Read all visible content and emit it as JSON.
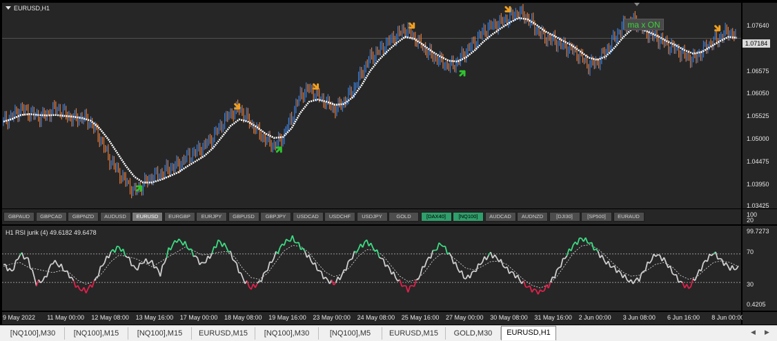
{
  "window": {
    "symbol_title": "EURUSD,H1",
    "overlay_label": "ma x ON"
  },
  "price_axis": {
    "current_price": "1.07184",
    "ticks": [
      "1.07640",
      "1.07115",
      "1.06575",
      "1.06050",
      "1.05525",
      "1.05000",
      "1.04475",
      "1.03950",
      "1.03425"
    ]
  },
  "symbol_buttons": [
    {
      "label": "GBPAUD",
      "state": "normal"
    },
    {
      "label": "GBPCAD",
      "state": "normal"
    },
    {
      "label": "GBPNZD",
      "state": "normal"
    },
    {
      "label": "AUDUSD",
      "state": "normal"
    },
    {
      "label": "EURUSD",
      "state": "active"
    },
    {
      "label": "EURGBP",
      "state": "normal"
    },
    {
      "label": "EURJPY",
      "state": "normal"
    },
    {
      "label": "GBPUSD",
      "state": "normal"
    },
    {
      "label": "GBPJPY",
      "state": "normal"
    },
    {
      "label": "USDCAD",
      "state": "normal"
    },
    {
      "label": "USDCHF",
      "state": "normal"
    },
    {
      "label": "USDJPY",
      "state": "normal"
    },
    {
      "label": "GOLD",
      "state": "normal"
    },
    {
      "label": "[DAX40]",
      "state": "highlight"
    },
    {
      "label": "[NQ100]",
      "state": "highlight"
    },
    {
      "label": "AUDCAD",
      "state": "normal"
    },
    {
      "label": "AUDNZD",
      "state": "normal"
    },
    {
      "label": "[DJI30]",
      "state": "normal"
    },
    {
      "label": "[SP500]",
      "state": "normal"
    },
    {
      "label": "EURAUD",
      "state": "normal"
    }
  ],
  "symbol_axis": {
    "top": "100",
    "bottom": "20"
  },
  "rsi": {
    "title": "H1  RSI jurik (4) 49.6182 49.6478",
    "ticks": [
      "99.7273",
      "70",
      "30",
      "0.4205"
    ]
  },
  "time_axis": [
    "9 May 2022",
    "11 May 00:00",
    "12 May 08:00",
    "13 May 16:00",
    "17 May 00:00",
    "18 May 08:00",
    "19 May 16:00",
    "23 May 00:00",
    "24 May 08:00",
    "25 May 16:00",
    "27 May 00:00",
    "30 May 08:00",
    "31 May 16:00",
    "2 Jun 00:00",
    "3 Jun 08:00",
    "6 Jun 16:00",
    "8 Jun 00:00"
  ],
  "tabs": [
    {
      "label": "[NQ100],M30",
      "active": false
    },
    {
      "label": "[NQ100],M15",
      "active": false
    },
    {
      "label": "[NQ100],M15",
      "active": false
    },
    {
      "label": "EURUSD,M15",
      "active": false
    },
    {
      "label": "[NQ100],M30",
      "active": false
    },
    {
      "label": "[NQ100],M5",
      "active": false
    },
    {
      "label": "EURUSD,M15",
      "active": false
    },
    {
      "label": "GOLD,M30",
      "active": false
    },
    {
      "label": "EURUSD,H1",
      "active": true
    }
  ],
  "tab_scroll": {
    "left_icon": "triangle-left-icon",
    "right_icon": "triangle-right-icon"
  },
  "colors": {
    "background": "#262626",
    "bull_bar": "#3d7fd8",
    "bear_bar": "#e07a3a",
    "ma_line": "#ffffff",
    "buy_arrow": "#2ec42e",
    "sell_arrow": "#f0a020",
    "rsi_high": "#3ddc84",
    "rsi_low": "#e0204c",
    "rsi_mid": "#cfcfcf"
  },
  "chart_data": {
    "type": "line",
    "title": "EURUSD,H1",
    "price_range": [
      1.03425,
      1.079
    ],
    "series": [
      {
        "name": "price",
        "values": [
          1.053,
          1.0542,
          1.0558,
          1.0551,
          1.054,
          1.0546,
          1.0562,
          1.0549,
          1.0536,
          1.054,
          1.0528,
          1.0495,
          1.045,
          1.042,
          1.0395,
          1.037,
          1.0388,
          1.0405,
          1.0412,
          1.0425,
          1.0432,
          1.045,
          1.0462,
          1.0475,
          1.0495,
          1.0525,
          1.0548,
          1.056,
          1.0535,
          1.051,
          1.049,
          1.0475,
          1.0495,
          1.054,
          1.059,
          1.0605,
          1.0588,
          1.0572,
          1.0558,
          1.0575,
          1.06,
          1.064,
          1.0675,
          1.069,
          1.071,
          1.0725,
          1.074,
          1.0722,
          1.07,
          1.068,
          1.0668,
          1.0655,
          1.0665,
          1.069,
          1.0712,
          1.0735,
          1.0748,
          1.0755,
          1.0768,
          1.0778,
          1.0765,
          1.074,
          1.072,
          1.0715,
          1.0702,
          1.0695,
          1.068,
          1.0658,
          1.0665,
          1.069,
          1.072,
          1.0748,
          1.076,
          1.0745,
          1.0728,
          1.0718,
          1.0705,
          1.0695,
          1.068,
          1.0672,
          1.069,
          1.0708,
          1.072,
          1.0735,
          1.072
        ]
      },
      {
        "name": "ma",
        "values": [
          1.053,
          1.0536,
          1.0545,
          1.0547,
          1.0545,
          1.0544,
          1.0545,
          1.0543,
          1.0541,
          1.0538,
          1.0532,
          1.0515,
          1.049,
          1.046,
          1.043,
          1.0405,
          1.0392,
          1.0392,
          1.0398,
          1.0406,
          1.0415,
          1.0428,
          1.044,
          1.0452,
          1.047,
          1.0495,
          1.052,
          1.0535,
          1.053,
          1.0518,
          1.0503,
          1.0493,
          1.0495,
          1.0515,
          1.055,
          1.0575,
          1.058,
          1.0575,
          1.0568,
          1.057,
          1.0585,
          1.0612,
          1.0645,
          1.067,
          1.069,
          1.0708,
          1.0722,
          1.0718,
          1.0705,
          1.069,
          1.0678,
          1.0668,
          1.0666,
          1.0676,
          1.0692,
          1.0712,
          1.0728,
          1.0742,
          1.0755,
          1.0765,
          1.0762,
          1.075,
          1.0735,
          1.0725,
          1.0714,
          1.0704,
          1.069,
          1.0675,
          1.067,
          1.0678,
          1.0698,
          1.0722,
          1.074,
          1.074,
          1.0732,
          1.0723,
          1.0712,
          1.0703,
          1.0692,
          1.0684,
          1.0688,
          1.07,
          1.0712,
          1.0722,
          1.072
        ]
      },
      {
        "name": "rsi",
        "values": [
          55,
          45,
          70,
          62,
          28,
          35,
          60,
          52,
          40,
          22,
          18,
          30,
          55,
          72,
          80,
          66,
          48,
          60,
          58,
          42,
          75,
          90,
          84,
          70,
          55,
          66,
          88,
          80,
          60,
          35,
          22,
          30,
          50,
          70,
          86,
          92,
          80,
          65,
          50,
          35,
          28,
          40,
          62,
          78,
          88,
          76,
          60,
          45,
          30,
          20,
          30,
          55,
          72,
          85,
          70,
          50,
          35,
          45,
          60,
          70,
          62,
          48,
          40,
          28,
          20,
          16,
          25,
          45,
          65,
          82,
          92,
          86,
          72,
          58,
          50,
          40,
          30,
          35,
          55,
          70,
          62,
          45,
          30,
          22,
          40,
          60,
          72,
          60,
          50,
          49.6
        ]
      }
    ]
  }
}
